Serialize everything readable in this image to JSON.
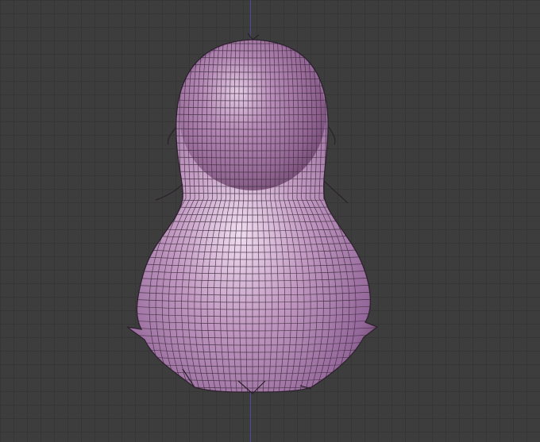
{
  "viewport": {
    "background_color": "#3d3d3d",
    "grid_color": "#363636",
    "axis_color": "#4b4b9a"
  },
  "mesh": {
    "object": "hair-mesh",
    "view": "back",
    "display": "wireframe-over-solid",
    "base_color": "#a87aa8",
    "highlight_color": "#e6cfe6",
    "shadow_color": "#6e476e",
    "wire_color": "#3a2a3a"
  }
}
